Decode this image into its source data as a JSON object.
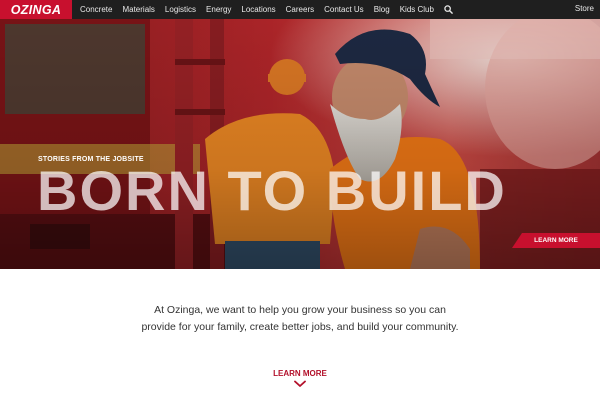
{
  "brand": {
    "logo_text": "OZINGA",
    "color": "#c8102e"
  },
  "nav": {
    "items": [
      {
        "label": "Concrete"
      },
      {
        "label": "Materials"
      },
      {
        "label": "Logistics"
      },
      {
        "label": "Energy"
      },
      {
        "label": "Locations"
      },
      {
        "label": "Careers"
      },
      {
        "label": "Contact Us"
      },
      {
        "label": "Blog"
      },
      {
        "label": "Kids Club"
      }
    ],
    "search_icon": "search-icon",
    "store_label": "Store"
  },
  "hero": {
    "eyebrow": "STORIES FROM THE JOBSITE",
    "headline": "BORN TO BUILD",
    "cta_label": "LEARN MORE"
  },
  "intro": {
    "text": "At Ozinga, we want to help you grow your business so you can provide for your family, create better jobs, and build your community."
  },
  "more": {
    "label": "LEARN MORE",
    "icon": "chevron-down-icon"
  }
}
